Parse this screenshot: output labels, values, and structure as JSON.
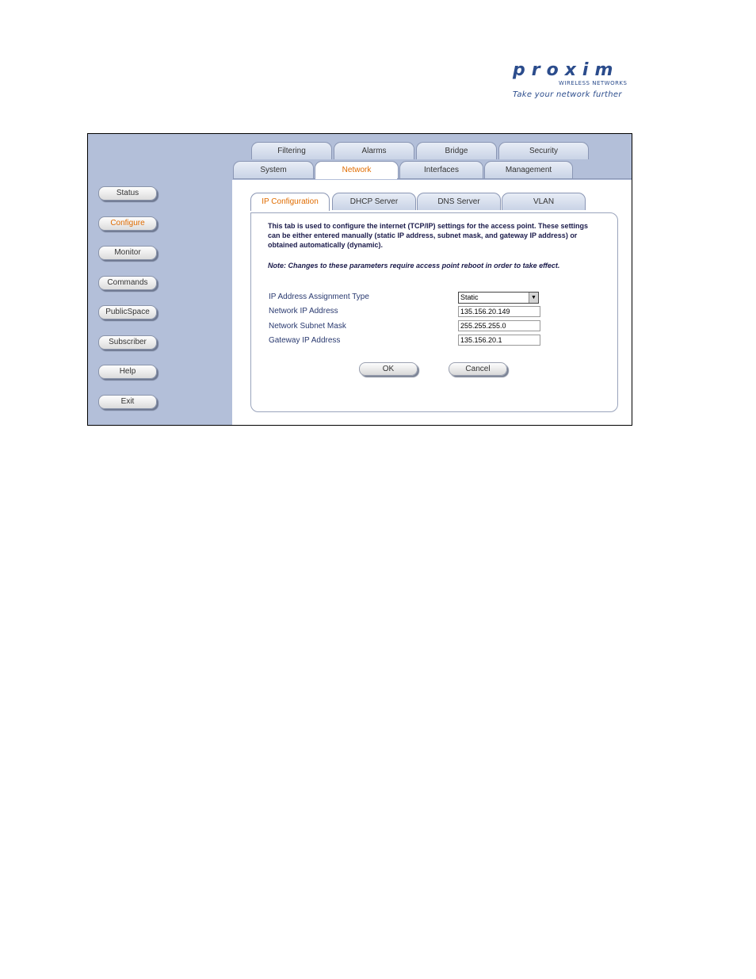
{
  "logo": {
    "wordmark": "proxim",
    "subtitle": "WIRELESS NETWORKS",
    "tagline": "Take your network further",
    "brand_color": "#2b4c8c"
  },
  "sidebar": {
    "items": [
      {
        "label": "Status"
      },
      {
        "label": "Configure",
        "active": true
      },
      {
        "label": "Monitor"
      },
      {
        "label": "Commands"
      },
      {
        "label": "PublicSpace"
      },
      {
        "label": "Subscriber"
      },
      {
        "label": "Help"
      },
      {
        "label": "Exit"
      }
    ]
  },
  "tabs": {
    "top_row": [
      "Filtering",
      "Alarms",
      "Bridge",
      "Security"
    ],
    "second_row": [
      "System",
      "Network",
      "Interfaces",
      "Management"
    ],
    "second_row_active": "Network",
    "sub_tabs": [
      "IP Configuration",
      "DHCP Server",
      "DNS Server",
      "VLAN"
    ],
    "sub_tabs_active": "IP Configuration"
  },
  "panel": {
    "intro": "This tab is used to configure the internet (TCP/IP) settings for the access point. These settings can be either entered manually (static IP address, subnet mask, and gateway IP address) or obtained automatically (dynamic).",
    "note": "Note: Changes to these parameters require access point reboot in order to take effect.",
    "fields": {
      "assignment_label": "IP Address Assignment Type",
      "assignment_value": "Static",
      "ip_label": "Network IP Address",
      "ip_value": "135.156.20.149",
      "mask_label": "Network Subnet Mask",
      "mask_value": "255.255.255.0",
      "gateway_label": "Gateway IP Address",
      "gateway_value": "135.156.20.1"
    },
    "ok_label": "OK",
    "cancel_label": "Cancel"
  },
  "colors": {
    "sidebar_bg": "#b3bfd9",
    "active_text": "#e06c00"
  }
}
